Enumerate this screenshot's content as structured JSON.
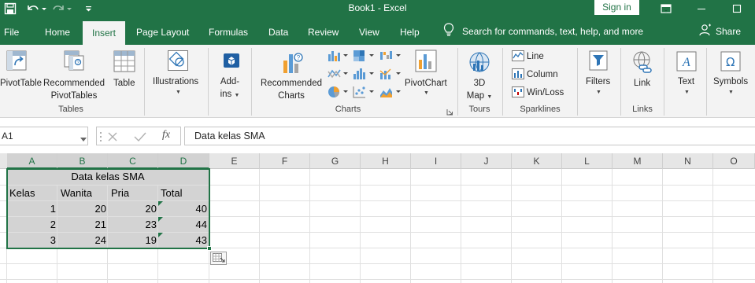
{
  "window": {
    "title": "Book1  -  Excel",
    "sign_in": "Sign in"
  },
  "tabs": [
    {
      "label": "File",
      "active": false
    },
    {
      "label": "Home",
      "active": false
    },
    {
      "label": "Insert",
      "active": true
    },
    {
      "label": "Page Layout",
      "active": false
    },
    {
      "label": "Formulas",
      "active": false
    },
    {
      "label": "Data",
      "active": false
    },
    {
      "label": "Review",
      "active": false
    },
    {
      "label": "View",
      "active": false
    },
    {
      "label": "Help",
      "active": false
    }
  ],
  "search": {
    "text": "Search for commands, text, help, and more"
  },
  "share": {
    "label": "Share"
  },
  "ribbon": {
    "tables": {
      "pivottable": "PivotTable",
      "recommended": [
        "Recommended",
        "PivotTables"
      ],
      "table": "Table",
      "group": "Tables"
    },
    "illustrations": {
      "label": "Illustrations"
    },
    "addins": {
      "label": [
        "Add-",
        "ins"
      ]
    },
    "charts": {
      "recommended": [
        "Recommended",
        "Charts"
      ],
      "pivotchart": "PivotChart",
      "group": "Charts"
    },
    "tours": {
      "map": [
        "3D",
        "Map"
      ],
      "group": "Tours"
    },
    "sparklines": {
      "line": "Line",
      "column": "Column",
      "winloss": "Win/Loss",
      "group": "Sparklines"
    },
    "filters": {
      "label": "Filters"
    },
    "links": {
      "label": "Link",
      "group": "Links"
    },
    "text": {
      "label": "Text"
    },
    "symbols": {
      "label": "Symbols"
    }
  },
  "formula_bar": {
    "name_box": "A1",
    "fx": "fx",
    "content": "Data kelas SMA"
  },
  "columns": [
    "A",
    "B",
    "C",
    "D",
    "E",
    "F",
    "G",
    "H",
    "I",
    "J",
    "K",
    "L",
    "M",
    "N",
    "O"
  ],
  "sheet": {
    "title": "Data kelas SMA",
    "headers": [
      "Kelas",
      "Wanita",
      "Pria",
      "Total"
    ],
    "rows": [
      [
        "1",
        "20",
        "20",
        "40"
      ],
      [
        "2",
        "21",
        "23",
        "44"
      ],
      [
        "3",
        "24",
        "19",
        "43"
      ]
    ]
  },
  "colors": {
    "accent": "#217346",
    "selection_fill": "#d3d3d3"
  },
  "icons": [
    "save-icon",
    "undo-icon",
    "redo-icon",
    "customize-qat-icon",
    "restore-window-icon",
    "minimize-icon",
    "maximize-icon",
    "lightbulb-icon",
    "person-icon",
    "pivottable-icon",
    "recommended-pivottables-icon",
    "table-icon",
    "illustrations-icon",
    "addins-icon",
    "recommended-charts-icon",
    "pivotchart-icon",
    "3d-map-icon",
    "sparkline-line-icon",
    "sparkline-column-icon",
    "sparkline-winloss-icon",
    "filter-icon",
    "link-icon",
    "text-icon",
    "omega-symbol-icon",
    "quick-analysis-icon"
  ]
}
